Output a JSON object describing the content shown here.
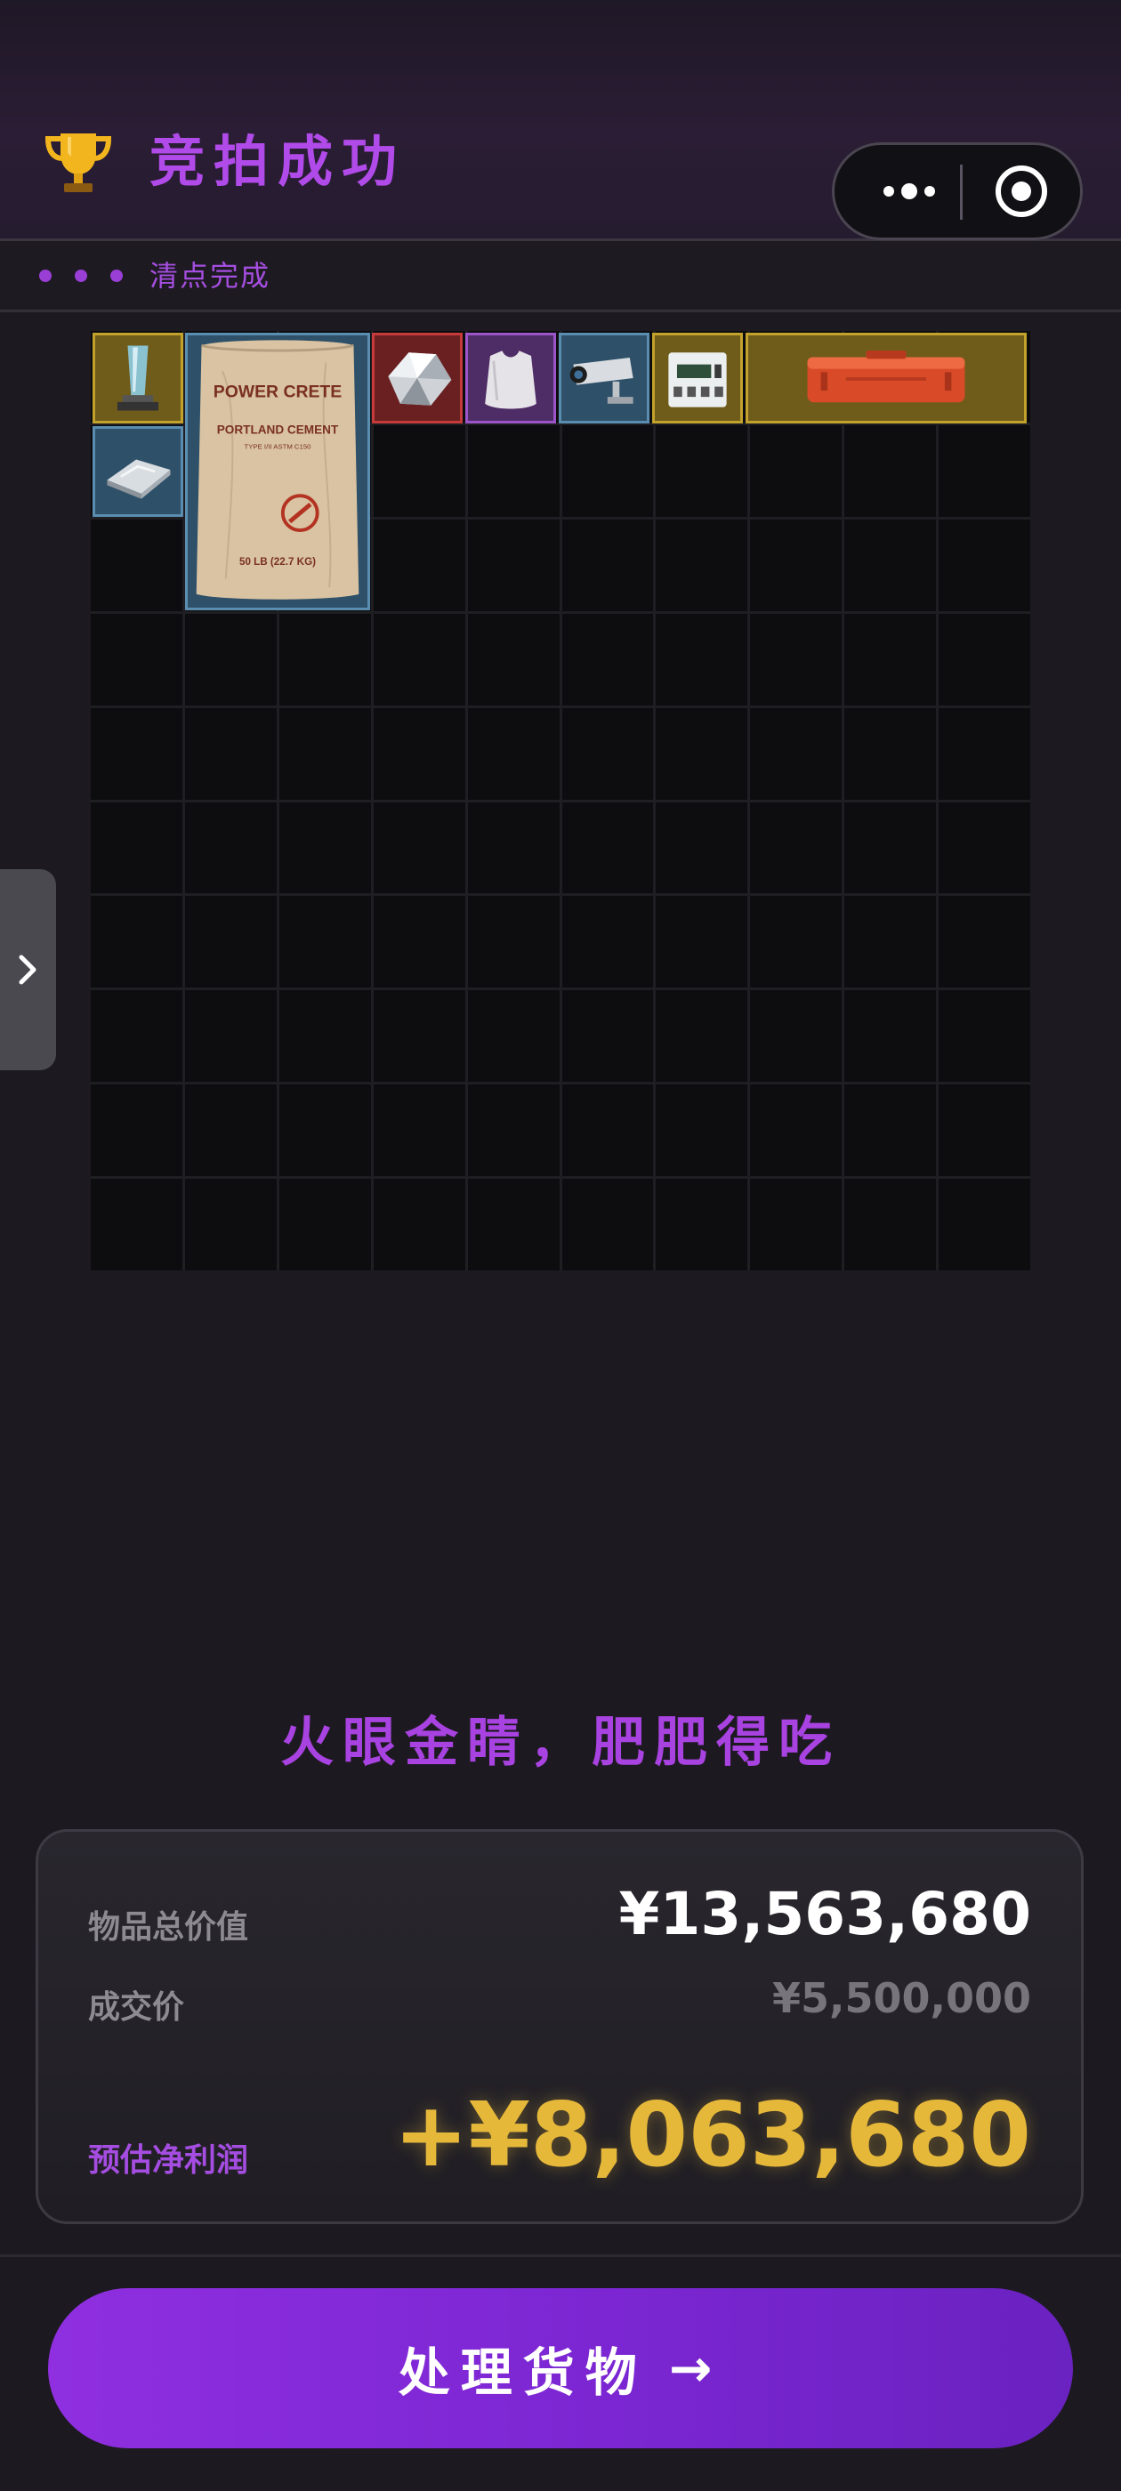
{
  "header": {
    "title": "竞拍成功",
    "icon": "trophy-icon"
  },
  "capsule": {
    "more_icon": "more-dots-icon",
    "close_icon": "target-circle-icon"
  },
  "status": {
    "label": "清点完成"
  },
  "inventory": {
    "grid": {
      "columns": 10,
      "rows": 10
    },
    "items": [
      {
        "name": "glass-trophy-item",
        "rarity": "gold"
      },
      {
        "name": "cement-bag-item",
        "rarity": "blue",
        "text_lines": [
          "POWER CRETE",
          "PORTLAND CEMENT",
          "TYPE I/II ASTM C150",
          "50 LB (22.7 KG)"
        ]
      },
      {
        "name": "diamond-item",
        "rarity": "red"
      },
      {
        "name": "body-armor-plate-item",
        "rarity": "purple"
      },
      {
        "name": "security-camera-item",
        "rarity": "blue"
      },
      {
        "name": "electric-meter-item",
        "rarity": "gold"
      },
      {
        "name": "orange-hard-case-item",
        "rarity": "gold"
      },
      {
        "name": "metal-ingot-item",
        "rarity": "blue"
      }
    ]
  },
  "side_tab": {
    "icon": "chevron-right-icon"
  },
  "slogan": "火眼金睛，肥肥得吃",
  "summary": {
    "total_label": "物品总价值",
    "total_value": "¥13,563,680",
    "deal_label": "成交价",
    "deal_value": "¥5,500,000",
    "profit_label": "预估净利润",
    "profit_value": "+¥8,063,680"
  },
  "cta": {
    "label": "处理货物",
    "arrow": "→"
  },
  "colors": {
    "accent": "#a842e0",
    "gold": "#e6b83a",
    "background": "#1c1a20"
  }
}
